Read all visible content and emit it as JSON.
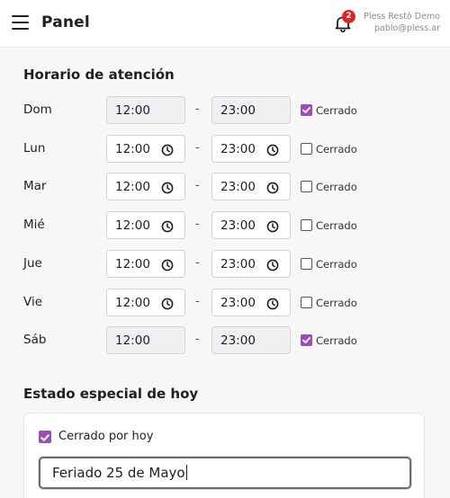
{
  "header": {
    "title": "Panel",
    "notification_count": "2",
    "user_name": "Pless Restó Demo",
    "user_email": "pablo@pless.ar"
  },
  "schedule": {
    "title": "Horario de atención",
    "closed_label": "Cerrado",
    "days": [
      {
        "day": "Dom",
        "from": "12:00",
        "to": "23:00",
        "closed": true
      },
      {
        "day": "Lun",
        "from": "12:00",
        "to": "23:00",
        "closed": false
      },
      {
        "day": "Mar",
        "from": "12:00",
        "to": "23:00",
        "closed": false
      },
      {
        "day": "Mié",
        "from": "12:00",
        "to": "23:00",
        "closed": false
      },
      {
        "day": "Jue",
        "from": "12:00",
        "to": "23:00",
        "closed": false
      },
      {
        "day": "Vie",
        "from": "12:00",
        "to": "23:00",
        "closed": false
      },
      {
        "day": "Sáb",
        "from": "12:00",
        "to": "23:00",
        "closed": true
      }
    ]
  },
  "special": {
    "title": "Estado especial de hoy",
    "closed_today_label": "Cerrado por hoy",
    "closed_today": true,
    "reason_value": "Feriado 25 de Mayo"
  },
  "colors": {
    "accent": "#9b4fb5",
    "badge": "#e02424",
    "text": "#1f1f24"
  },
  "icons": {
    "menu": "hamburger-menu-icon",
    "notifications": "bell-icon",
    "time": "clock-icon",
    "check": "checkmark-icon"
  }
}
